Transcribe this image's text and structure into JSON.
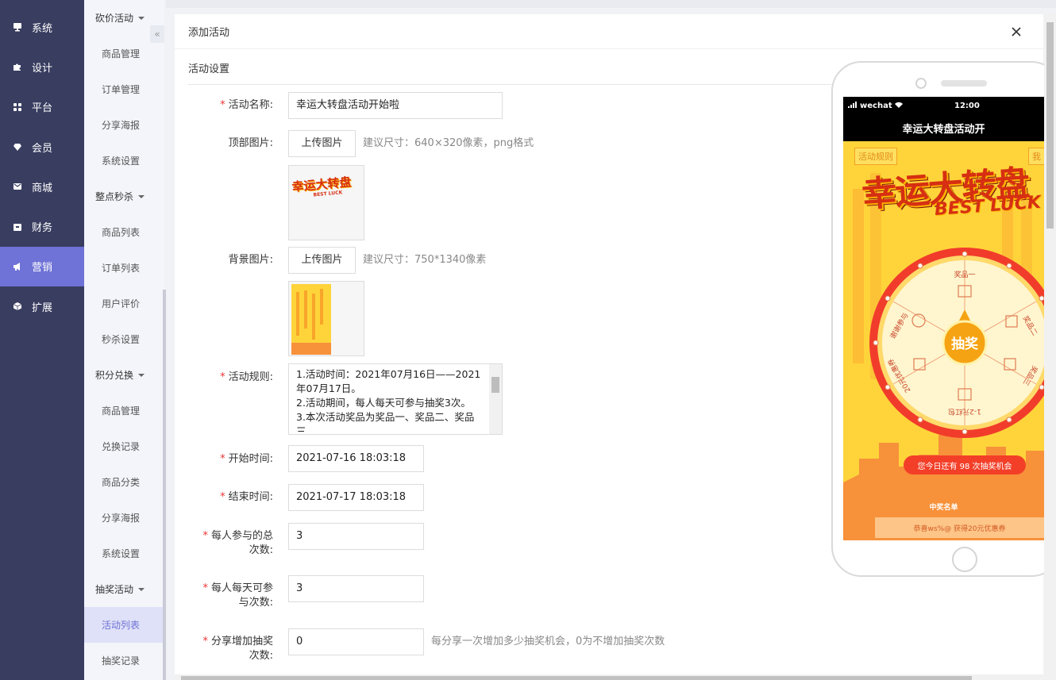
{
  "nav": {
    "items": [
      {
        "label": "系统",
        "icon": "monitor-icon"
      },
      {
        "label": "设计",
        "icon": "puzzle-icon"
      },
      {
        "label": "平台",
        "icon": "grid-icon"
      },
      {
        "label": "会员",
        "icon": "diamond-icon"
      },
      {
        "label": "商城",
        "icon": "mail-icon"
      },
      {
        "label": "财务",
        "icon": "wallet-icon"
      },
      {
        "label": "营销",
        "icon": "megaphone-icon",
        "active": true
      },
      {
        "label": "扩展",
        "icon": "cube-icon"
      }
    ],
    "active_color": "#6f72d6",
    "bg_color": "#393d60"
  },
  "submenu": {
    "collapse_glyph": "«",
    "groups": [
      {
        "label": "砍价活动",
        "items": [
          "商品管理",
          "订单管理",
          "分享海报",
          "系统设置"
        ]
      },
      {
        "label": "整点秒杀",
        "items": [
          "商品列表",
          "订单列表",
          "用户评价",
          "秒杀设置"
        ]
      },
      {
        "label": "积分兑换",
        "items": [
          "商品管理",
          "兑换记录",
          "商品分类",
          "分享海报",
          "系统设置"
        ]
      },
      {
        "label": "抽奖活动",
        "items": [
          "活动列表",
          "抽奖记录"
        ]
      }
    ],
    "active_item": "活动列表"
  },
  "panel": {
    "title": "添加活动",
    "section": "活动设置"
  },
  "form": {
    "name_label": "活动名称:",
    "name_value": "幸运大转盘活动开始啦",
    "top_image_label": "顶部图片:",
    "upload_label": "上传图片",
    "top_image_hint": "建议尺寸：640×320像素，png格式",
    "bg_image_label": "背景图片:",
    "bg_image_hint": "建议尺寸：750*1340像素",
    "rules_label": "活动规则:",
    "rules_lines": [
      "1.活动时间：2021年07月16日——2021",
      "年07月17日。",
      "2.活动期间，每人每天可参与抽奖3次。",
      "3.本次活动奖品为奖品一、奖品二、奖品",
      "三"
    ],
    "start_label": "开始时间:",
    "start_value": "2021-07-16 18:03:18",
    "end_label": "结束时间:",
    "end_value": "2021-07-17 18:03:18",
    "total_label_1": "每人参与的总",
    "total_label_2": "次数:",
    "total_value": "3",
    "daily_label_1": "每人每天可参",
    "daily_label_2": "与次数:",
    "daily_value": "3",
    "share_label_1": "分享增加抽奖",
    "share_label_2": "次数:",
    "share_value": "0",
    "share_hint": "每分享一次增加多少抽奖机会，0为不增加抽奖次数"
  },
  "preview": {
    "carrier": "wechat",
    "time": "12:00",
    "title": "幸运大转盘活动开",
    "rule_tag": "活动规则",
    "my_tag": "我",
    "banner_main": "幸运大转盘",
    "banner_sub": "BEST LUCK",
    "wheel_center": "抽奖",
    "segments": [
      "奖品一",
      "奖品二",
      "奖品三",
      "1-2元红包",
      "20元优惠券",
      "谢谢参与"
    ],
    "chances_text": "您今日还有 98 次抽奖机会",
    "winners_title": "中奖名单",
    "winners_row": "恭喜ws%@ 获得20元优惠券",
    "thumb_top_text": "幸运大转盘",
    "thumb_top_sub": "BEST LUCK"
  }
}
